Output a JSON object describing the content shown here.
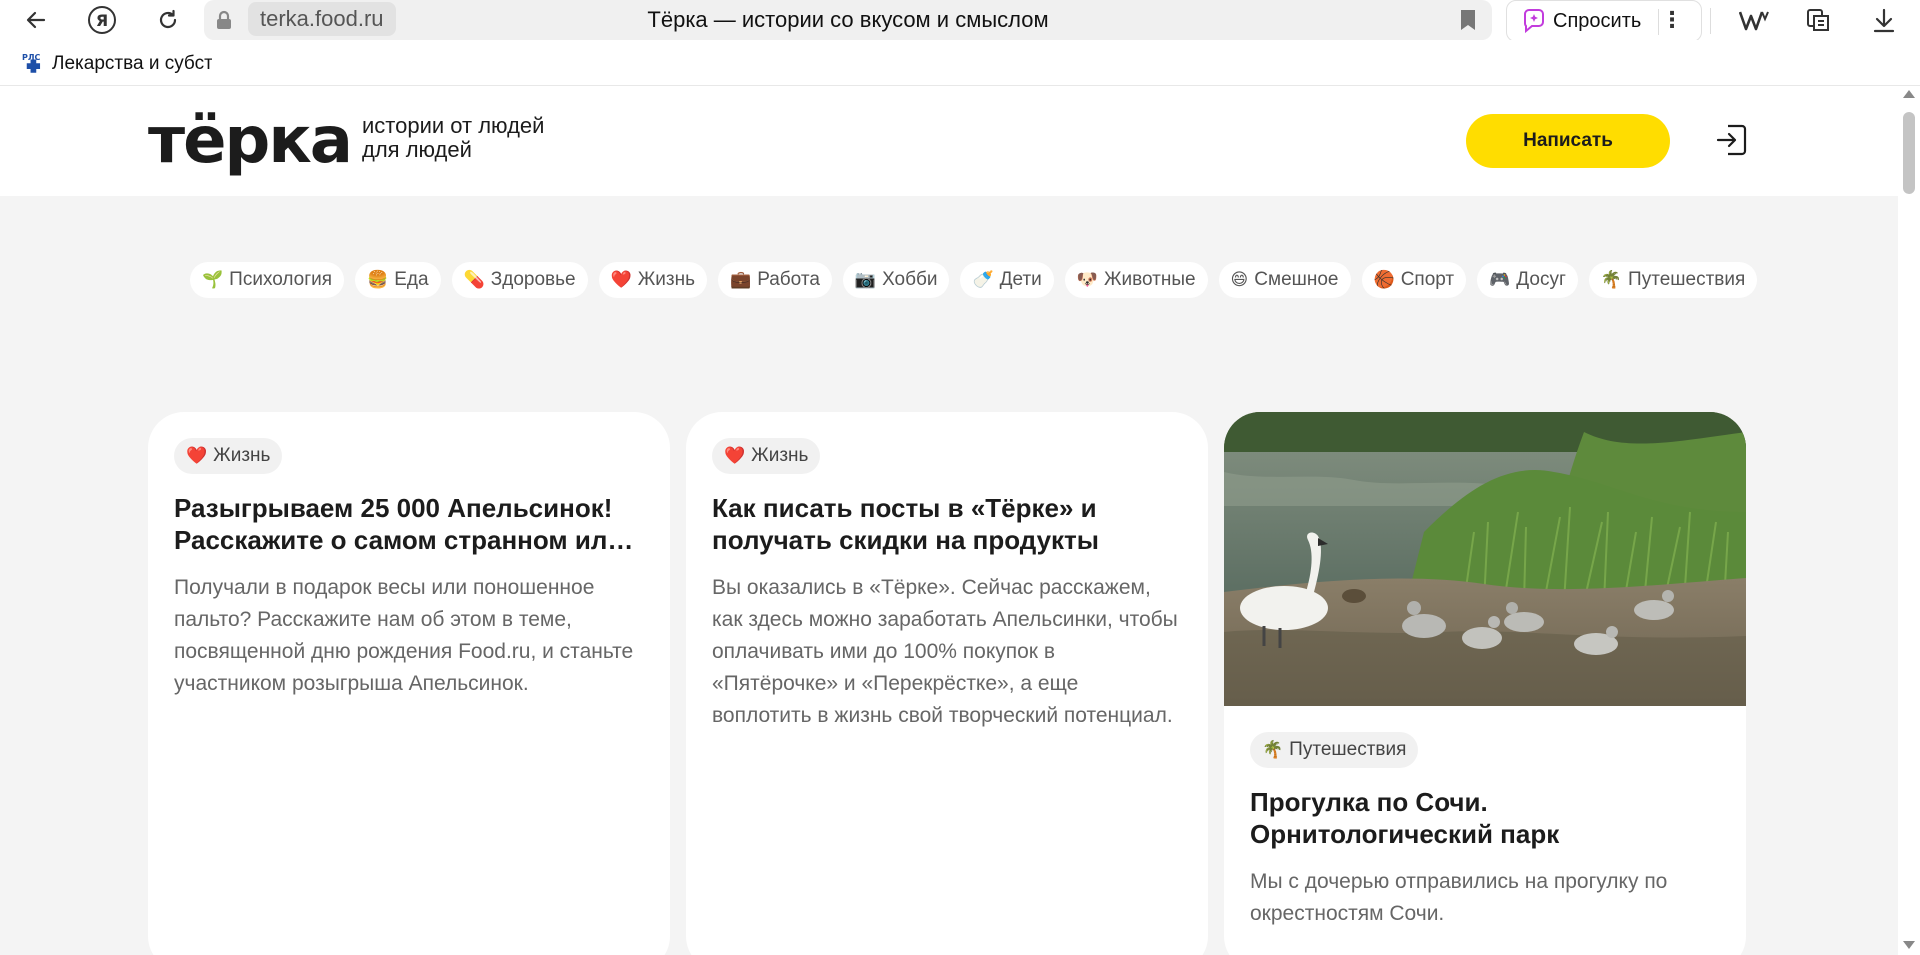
{
  "browser": {
    "url": "terka.food.ru",
    "tab_title": "Тёрка — истории со вкусом и смыслом",
    "ask_label": "Спросить",
    "yandex_glyph": "Я"
  },
  "bookmarks": [
    {
      "label": "Лекарства и субстанции",
      "icon": "rls-icon"
    }
  ],
  "header": {
    "logo": "тёрка",
    "tagline_line1": "истории от людей",
    "tagline_line2": "для людей",
    "write_label": "Написать"
  },
  "categories": [
    {
      "emoji": "🌱",
      "label": "Психология"
    },
    {
      "emoji": "🍔",
      "label": "Еда"
    },
    {
      "emoji": "💊",
      "label": "Здоровье"
    },
    {
      "emoji": "❤️",
      "label": "Жизнь"
    },
    {
      "emoji": "💼",
      "label": "Работа"
    },
    {
      "emoji": "📷",
      "label": "Хобби"
    },
    {
      "emoji": "🍼",
      "label": "Дети"
    },
    {
      "emoji": "🐶",
      "label": "Животные"
    },
    {
      "emoji": "😄",
      "label": "Смешное"
    },
    {
      "emoji": "🏀",
      "label": "Спорт"
    },
    {
      "emoji": "🎮",
      "label": "Досуг"
    },
    {
      "emoji": "🌴",
      "label": "Путешествия"
    }
  ],
  "cards": [
    {
      "tag_emoji": "❤️",
      "tag": "Жизнь",
      "title": "Разыгрываем 25 000 Апельсинок! Расскажите о самом странном ил…",
      "text": "Получали в подарок весы или поношенное пальто? Расскажите нам об этом в теме, посвященной дню рождения Food.ru, и станьте участником розыгрыша Апельсинок."
    },
    {
      "tag_emoji": "❤️",
      "tag": "Жизнь",
      "title": "Как писать посты в «Тёрке» и получать скидки на продукты",
      "text": "Вы оказались в «Тёрке». Сейчас расскажем, как здесь можно заработать Апельсинки, чтобы оплачивать ими до 100% покупок в «Пятёрочке» и «Перекрёстке», а еще воплотить в жизнь свой творческий потенциал."
    },
    {
      "tag_emoji": "🌴",
      "tag": "Путешествия",
      "title": "Прогулка по Сочи. Орнитологический парк",
      "text": "Мы с дочерью отправились на прогулку по окрестностям Сочи."
    }
  ],
  "colors": {
    "accent_yellow": "#ffdd00",
    "page_bg": "#f4f4f4"
  }
}
